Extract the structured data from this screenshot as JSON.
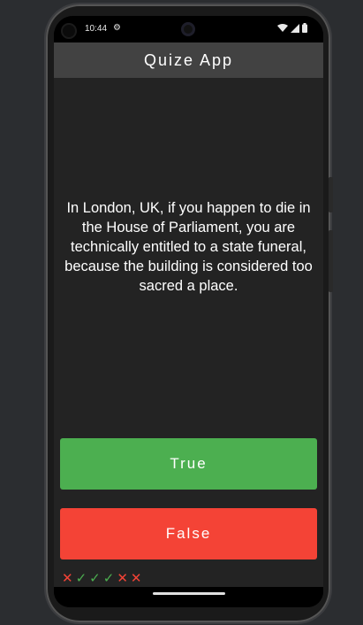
{
  "status_bar": {
    "time": "10:44",
    "settings_icon": "gear-icon",
    "wifi_icon": "wifi-icon",
    "signal_icon": "signal-icon",
    "battery_icon": "battery-icon"
  },
  "app_bar": {
    "title": "Quize App"
  },
  "question": {
    "text": "In London, UK, if you happen to die in the House of Parliament, you are technically entitled to a state funeral, because the building is considered too sacred a place."
  },
  "buttons": {
    "true_label": "True",
    "false_label": "False"
  },
  "score_keeper": {
    "marks": [
      {
        "result": "wrong",
        "glyph": "✕"
      },
      {
        "result": "right",
        "glyph": "✓"
      },
      {
        "result": "right",
        "glyph": "✓"
      },
      {
        "result": "right",
        "glyph": "✓"
      },
      {
        "result": "wrong",
        "glyph": "✕"
      },
      {
        "result": "wrong",
        "glyph": "✕"
      }
    ]
  },
  "colors": {
    "true_button": "#4caf50",
    "false_button": "#f44336",
    "app_bar": "#424242",
    "background": "#232323"
  }
}
